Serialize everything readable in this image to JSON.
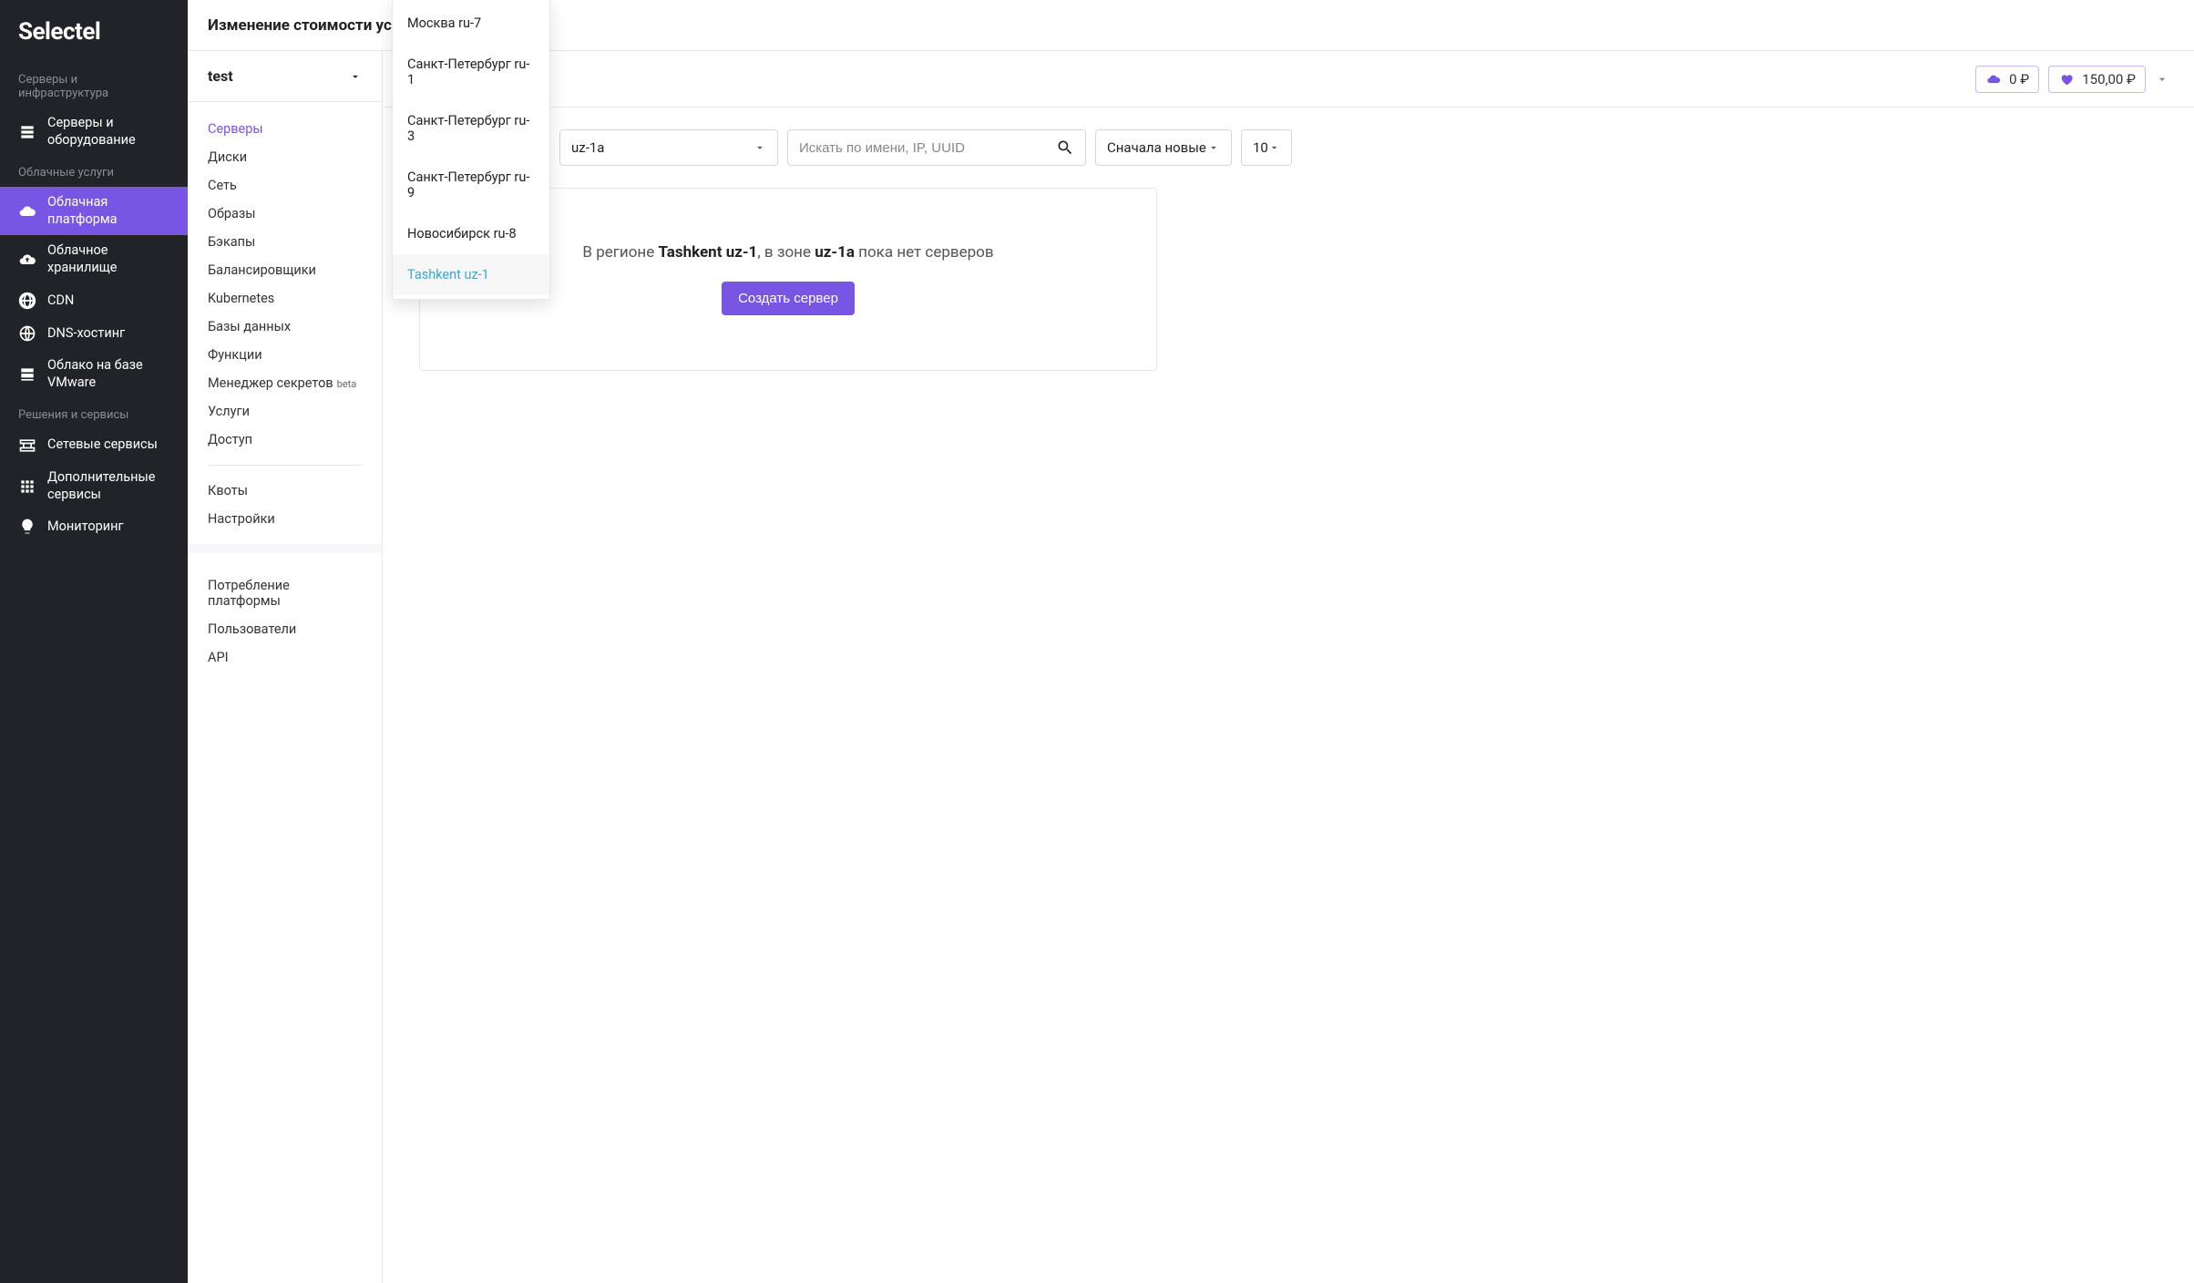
{
  "brand": "Selectel",
  "topbar": {
    "title": "Изменение стоимости услу"
  },
  "sidebar_primary": {
    "sections": [
      {
        "label": "Серверы и инфраструктура",
        "items": [
          {
            "id": "servers-hw",
            "label": "Серверы и оборудование",
            "icon": "servers"
          }
        ]
      },
      {
        "label": "Облачные услуги",
        "items": [
          {
            "id": "cloud-platform",
            "label": "Облачная платформа",
            "icon": "cloud-s",
            "active": true
          },
          {
            "id": "cloud-storage",
            "label": "Облачное хранилище",
            "icon": "cloud-up"
          },
          {
            "id": "cdn",
            "label": "CDN",
            "icon": "globe"
          },
          {
            "id": "dns",
            "label": "DNS-хостинг",
            "icon": "globe-lines"
          },
          {
            "id": "vmware",
            "label": "Облако на базе VMware",
            "icon": "stack"
          }
        ]
      },
      {
        "label": "Решения и сервисы",
        "items": [
          {
            "id": "net-services",
            "label": "Сетевые сервисы",
            "icon": "network"
          },
          {
            "id": "extra-services",
            "label": "Дополнительные сервисы",
            "icon": "grid"
          },
          {
            "id": "monitoring",
            "label": "Мониторинг",
            "icon": "bulb"
          }
        ]
      }
    ]
  },
  "sidebar_secondary": {
    "project_name": "test",
    "items": [
      {
        "label": "Серверы",
        "active": true
      },
      {
        "label": "Диски"
      },
      {
        "label": "Сеть"
      },
      {
        "label": "Образы"
      },
      {
        "label": "Бэкапы"
      },
      {
        "label": "Балансировщики"
      },
      {
        "label": "Kubernetes"
      },
      {
        "label": "Базы данных"
      },
      {
        "label": "Функции"
      },
      {
        "label": "Менеджер секретов",
        "badge": "beta"
      },
      {
        "label": "Услуги"
      },
      {
        "label": "Доступ"
      }
    ],
    "items2": [
      {
        "label": "Квоты"
      },
      {
        "label": "Настройки"
      }
    ],
    "items3": [
      {
        "label": "Потребление платформы"
      },
      {
        "label": "Пользователи"
      },
      {
        "label": "API"
      }
    ]
  },
  "prices": {
    "cloud": "0 ₽",
    "favorite": "150,00 ₽"
  },
  "filters": {
    "zone": "uz-1a",
    "search_placeholder": "Искать по имени, IP, UUID",
    "sort": "Сначала новые",
    "page_size": "10"
  },
  "region_dropdown": {
    "options": [
      "Москва ru-7",
      "Санкт-Петербург ru-1",
      "Санкт-Петербург ru-3",
      "Санкт-Петербург ru-9",
      "Новосибирск ru-8",
      "Tashkent uz-1"
    ],
    "selected": "Tashkent uz-1"
  },
  "empty": {
    "prefix": "В регионе ",
    "region": "Tashkent uz-1",
    "middle": ", в зоне ",
    "zone": "uz-1a",
    "suffix": " пока нет серверов",
    "button": "Создать сервер"
  }
}
